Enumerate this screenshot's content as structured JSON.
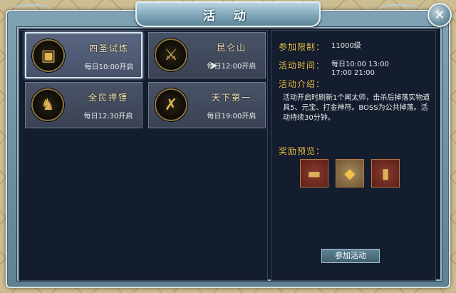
{
  "window": {
    "title": "活 动",
    "close_label": "✕"
  },
  "activities": [
    {
      "name": "四圣试炼",
      "time": "每日10:00开启",
      "icon": "treasure-chest-icon",
      "icon_glyph": "▣",
      "selected": true
    },
    {
      "name": "昆仑山",
      "time": "每日12:00开启",
      "icon": "golden-sword-icon",
      "icon_glyph": "⚔"
    },
    {
      "name": "全民押镖",
      "time": "每日12:30开启",
      "icon": "warrior-icon",
      "icon_glyph": "♞"
    },
    {
      "name": "天下第一",
      "time": "每日19:00开启",
      "icon": "crossed-swords-icon",
      "icon_glyph": "✗"
    }
  ],
  "details": {
    "requirement_label": "参加限制：",
    "requirement_value": "11000级",
    "time_label": "活动时间：",
    "time_line1": "每日10:00  13:00",
    "time_line2": "17:00  21:00",
    "intro_label": "活动介绍：",
    "intro_text": "活动开启时刷新1个闻太师，击杀后掉落实物道具5、元宝、打金神符。BOSS为公共掉落。活动持续30分钟。",
    "rewards_label": "奖励预览：",
    "rewards": [
      {
        "icon": "scroll-item-icon",
        "glyph": "▬",
        "style": "red"
      },
      {
        "icon": "gold-ingot-icon",
        "glyph": "◆",
        "style": "gold"
      },
      {
        "icon": "talisman-item-icon",
        "glyph": "▮",
        "style": "red"
      }
    ],
    "join_button": "参加活动"
  },
  "colors": {
    "accent_gold": "#e8c35a",
    "panel_bg": "#141d2e",
    "frame_blue": "#7fa3b5"
  }
}
